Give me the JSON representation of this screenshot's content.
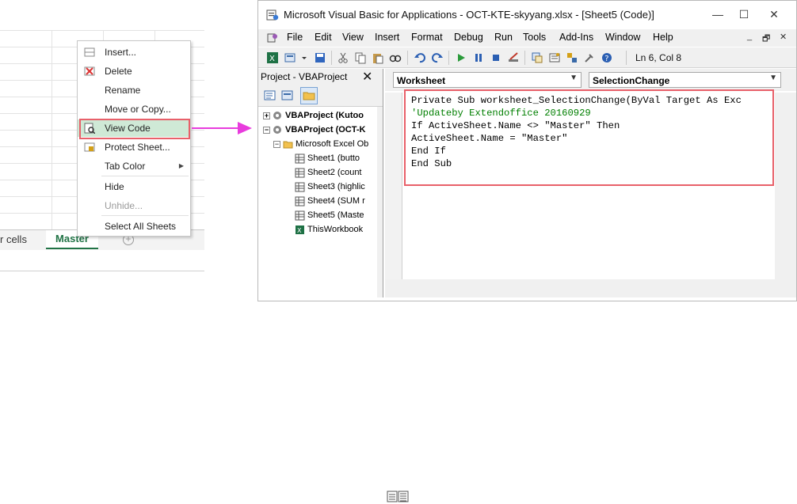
{
  "excel": {
    "sheet_tabs": [
      {
        "label": "r cells"
      },
      {
        "label": "Master"
      }
    ],
    "add_sheet_symbol": "+",
    "context_menu": {
      "items": [
        {
          "label": "Insert...",
          "icon": "insert-icon"
        },
        {
          "label": "Delete",
          "icon": "delete-icon"
        },
        {
          "label": "Rename",
          "icon": ""
        },
        {
          "label": "Move or Copy...",
          "icon": ""
        },
        {
          "label": "View Code",
          "icon": "view-code-icon",
          "highlighted": true
        },
        {
          "label": "Protect Sheet...",
          "icon": "protect-sheet-icon"
        },
        {
          "label": "Tab Color",
          "icon": "",
          "submenu": true
        },
        {
          "label": "Hide",
          "icon": ""
        },
        {
          "label": "Unhide...",
          "icon": "",
          "disabled": true
        },
        {
          "label": "Select All Sheets",
          "icon": ""
        }
      ]
    },
    "accent_color": "#217346",
    "highlight_color": "#e8606a",
    "arrow_color": "#e83cdd"
  },
  "vba": {
    "title": "Microsoft Visual Basic for Applications - OCT-KTE-skyyang.xlsx - [Sheet5 (Code)]",
    "window_buttons": [
      "—",
      "☐",
      "✕"
    ],
    "menu": [
      "File",
      "Edit",
      "View",
      "Insert",
      "Format",
      "Debug",
      "Run",
      "Tools",
      "Add-Ins",
      "Window",
      "Help"
    ],
    "mdi_buttons": [
      "_",
      "🗗",
      "✕"
    ],
    "status": "Ln 6, Col 8",
    "project_pane": {
      "title": "Project - VBAProject",
      "close": "✕",
      "tree": [
        {
          "label": "VBAProject (Kutoo",
          "level": 0,
          "bold": true,
          "expander": "+",
          "icon": "vbaproject-icon"
        },
        {
          "label": "VBAProject (OCT-K",
          "level": 0,
          "bold": true,
          "expander": "−",
          "icon": "vbaproject-icon"
        },
        {
          "label": "Microsoft Excel Ob",
          "level": 1,
          "bold": false,
          "expander": "−",
          "icon": "folder-icon"
        },
        {
          "label": "Sheet1 (butto",
          "level": 2,
          "bold": false,
          "expander": "",
          "icon": "sheet-icon"
        },
        {
          "label": "Sheet2 (count",
          "level": 2,
          "bold": false,
          "expander": "",
          "icon": "sheet-icon"
        },
        {
          "label": "Sheet3 (highlic",
          "level": 2,
          "bold": false,
          "expander": "",
          "icon": "sheet-icon"
        },
        {
          "label": "Sheet4 (SUM r",
          "level": 2,
          "bold": false,
          "expander": "",
          "icon": "sheet-icon"
        },
        {
          "label": "Sheet5 (Maste",
          "level": 2,
          "bold": false,
          "expander": "",
          "icon": "sheet-icon"
        },
        {
          "label": "ThisWorkbook",
          "level": 2,
          "bold": false,
          "expander": "",
          "icon": "workbook-icon"
        }
      ]
    },
    "code_pane": {
      "object_combo": "Worksheet",
      "procedure_combo": "SelectionChange",
      "lines": [
        {
          "text": "Private Sub worksheet_SelectionChange(ByVal Target As Exc",
          "type": "code"
        },
        {
          "text": "'Updateby Extendoffice 20160929",
          "type": "comment"
        },
        {
          "text": "If ActiveSheet.Name <> \"Master\" Then",
          "type": "code"
        },
        {
          "text": "ActiveSheet.Name = \"Master\"",
          "type": "code"
        },
        {
          "text": "End If",
          "type": "code"
        },
        {
          "text": "End Sub",
          "type": "code"
        }
      ]
    }
  }
}
